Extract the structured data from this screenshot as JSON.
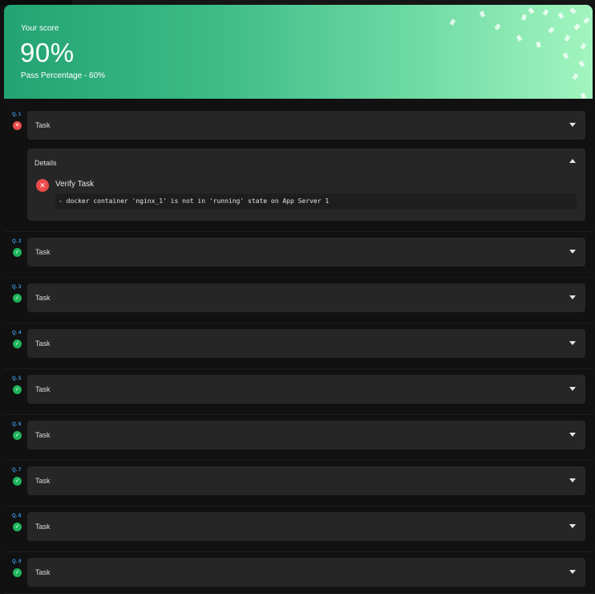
{
  "banner": {
    "score_label": "Your score",
    "score_value": "90%",
    "pass_text": "Pass Percentage - 60%"
  },
  "questions": [
    {
      "number": "Q. 1",
      "task_label": "Task",
      "status": "failed",
      "status_icon": "x-icon",
      "expanded": true
    },
    {
      "number": "Q. 2",
      "task_label": "Task",
      "status": "passed",
      "status_icon": "check-icon",
      "expanded": false
    },
    {
      "number": "Q. 3",
      "task_label": "Task",
      "status": "passed",
      "status_icon": "check-icon",
      "expanded": false
    },
    {
      "number": "Q. 4",
      "task_label": "Task",
      "status": "passed",
      "status_icon": "check-icon",
      "expanded": false
    },
    {
      "number": "Q. 5",
      "task_label": "Task",
      "status": "passed",
      "status_icon": "check-icon",
      "expanded": false
    },
    {
      "number": "Q. 6",
      "task_label": "Task",
      "status": "passed",
      "status_icon": "check-icon",
      "expanded": false
    },
    {
      "number": "Q. 7",
      "task_label": "Task",
      "status": "passed",
      "status_icon": "check-icon",
      "expanded": false
    },
    {
      "number": "Q. 8",
      "task_label": "Task",
      "status": "passed",
      "status_icon": "check-icon",
      "expanded": false
    },
    {
      "number": "Q. 9",
      "task_label": "Task",
      "status": "passed",
      "status_icon": "check-icon",
      "expanded": false
    }
  ],
  "details": {
    "title": "Details",
    "verify_title": "Verify Task",
    "message": "- docker container 'nginx_1' is not in 'running' state on App Server 1"
  },
  "colors": {
    "banner_start": "#23a373",
    "banner_end": "#a2f5bf",
    "pass": "#1fb45b",
    "fail": "#ea4a4a",
    "question_number": "#3d9be9"
  }
}
